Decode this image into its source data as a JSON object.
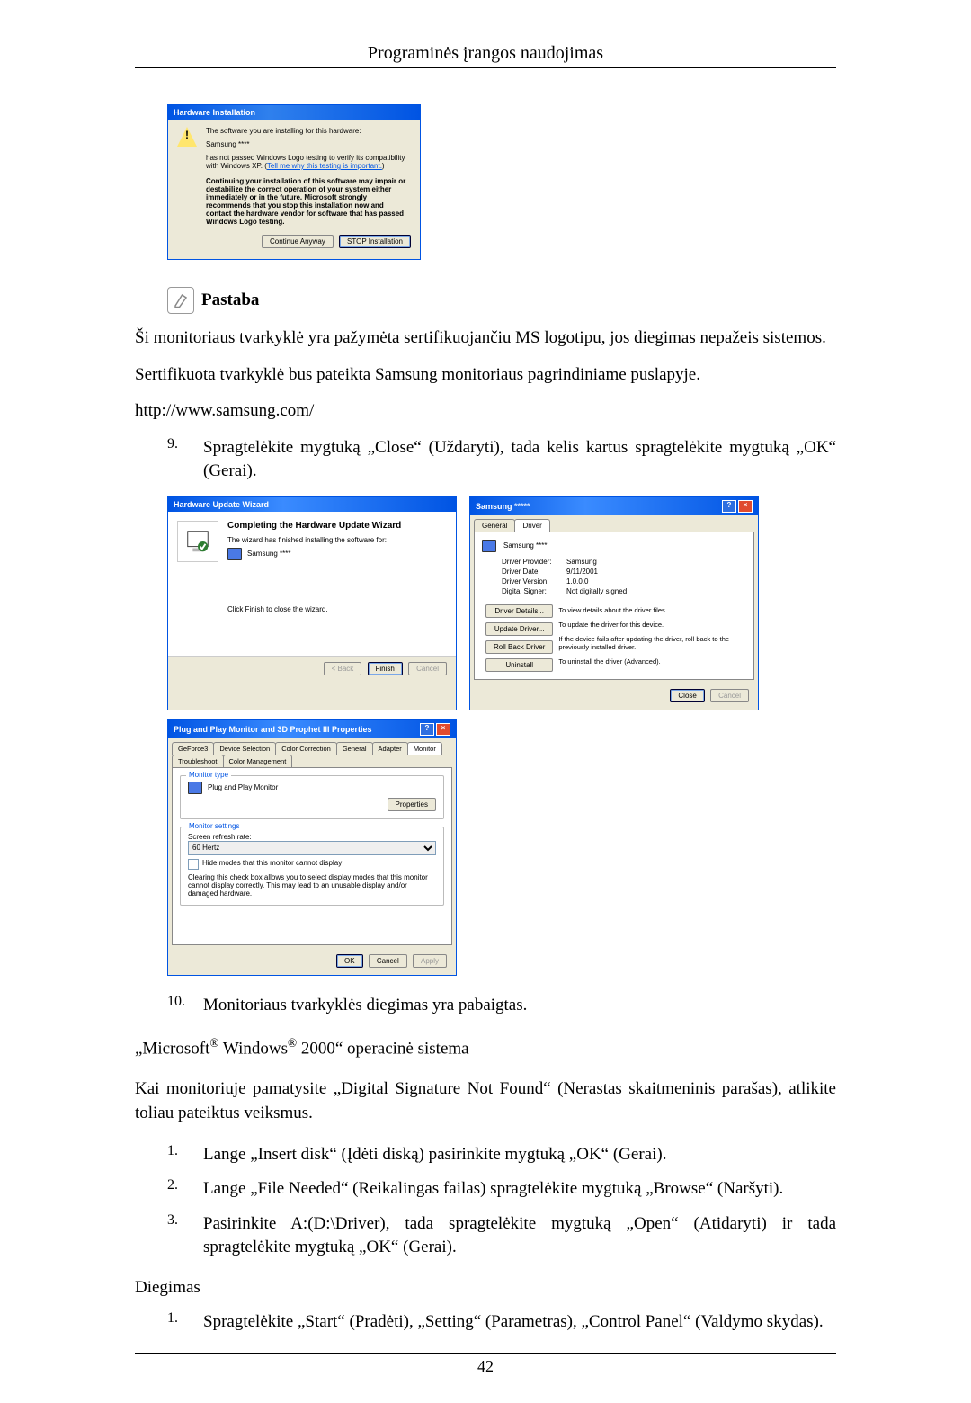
{
  "header": {
    "title": "Programinės įrangos naudojimas"
  },
  "page_number": "42",
  "hw_install": {
    "title": "Hardware Installation",
    "line1": "The software you are installing for this hardware:",
    "device": "Samsung ****",
    "line2a": "has not passed Windows Logo testing to verify its compatibility with Windows XP. (",
    "link": "Tell me why this testing is important.",
    "line2b": ")",
    "bold": "Continuing your installation of this software may impair or destabilize the correct operation of your system either immediately or in the future. Microsoft strongly recommends that you stop this installation now and contact the hardware vendor for software that has passed Windows Logo testing.",
    "btn_continue": "Continue Anyway",
    "btn_stop": "STOP Installation"
  },
  "note_label": "Pastaba",
  "para1": "Ši monitoriaus tvarkyklė yra pažymėta sertifikuojančiu MS logotipu, jos diegimas nepažeis sistemos.",
  "para2": "Sertifikuota tvarkyklė bus pateikta Samsung monitoriaus pagrindiniame puslapyje.",
  "url": "http://www.samsung.com/",
  "step9": "Spragtelėkite mygtuką „Close“ (Uždaryti), tada kelis kartus spragtelėkite mygtuką „OK“ (Gerai).",
  "wizard": {
    "title": "Hardware Update Wizard",
    "h": "Completing the Hardware Update Wizard",
    "line": "The wizard has finished installing the software for:",
    "device": "Samsung ****",
    "finish_line": "Click Finish to close the wizard.",
    "btn_back": "< Back",
    "btn_finish": "Finish",
    "btn_cancel": "Cancel"
  },
  "driver_props": {
    "title": "Samsung *****",
    "tab_general": "General",
    "tab_driver": "Driver",
    "device": "Samsung ****",
    "provider_k": "Driver Provider:",
    "provider_v": "Samsung",
    "date_k": "Driver Date:",
    "date_v": "9/11/2001",
    "version_k": "Driver Version:",
    "version_v": "1.0.0.0",
    "signer_k": "Digital Signer:",
    "signer_v": "Not digitally signed",
    "btn_details": "Driver Details...",
    "desc_details": "To view details about the driver files.",
    "btn_update": "Update Driver...",
    "desc_update": "To update the driver for this device.",
    "btn_rollback": "Roll Back Driver",
    "desc_rollback": "If the device fails after updating the driver, roll back to the previously installed driver.",
    "btn_uninstall": "Uninstall",
    "desc_uninstall": "To uninstall the driver (Advanced).",
    "btn_close": "Close",
    "btn_cancel": "Cancel"
  },
  "pnp": {
    "title": "Plug and Play Monitor and 3D Prophet III Properties",
    "tabs": [
      "GeForce3",
      "Device Selection",
      "Color Correction",
      "General",
      "Adapter",
      "Monitor",
      "Troubleshoot",
      "Color Management"
    ],
    "active_tab": "Monitor",
    "grp_type": "Monitor type",
    "monitor_name": "Plug and Play Monitor",
    "btn_properties": "Properties",
    "grp_settings": "Monitor settings",
    "refresh_label": "Screen refresh rate:",
    "refresh_value": "60 Hertz",
    "hide_checkbox": "Hide modes that this monitor cannot display",
    "hide_desc": "Clearing this check box allows you to select display modes that this monitor cannot display correctly. This may lead to an unusable display and/or damaged hardware.",
    "btn_ok": "OK",
    "btn_cancel": "Cancel",
    "btn_apply": "Apply"
  },
  "step10": "Monitoriaus tvarkyklės diegimas yra pabaigtas.",
  "os_line": "„Microsoft® Windows® 2000“ operacinė sistema",
  "para3": "Kai monitoriuje pamatysite „Digital Signature Not Found“ (Nerastas skaitmeninis parašas), atlikite toliau pateiktus veiksmus.",
  "s1": "Lange „Insert disk“ (Įdėti diską) pasirinkite mygtuką „OK“ (Gerai).",
  "s2": "Lange „File Needed“ (Reikalingas failas) spragtelėkite mygtuką „Browse“ (Naršyti).",
  "s3": "Pasirinkite A:(D:\\Driver), tada spragtelėkite mygtuką „Open“ (Atidaryti) ir tada spragtelėkite mygtuką „OK“ (Gerai).",
  "install_heading": "Diegimas",
  "d1": "Spragtelėkite „Start“ (Pradėti), „Setting“ (Parametras), „Control Panel“ (Valdymo skydas)."
}
